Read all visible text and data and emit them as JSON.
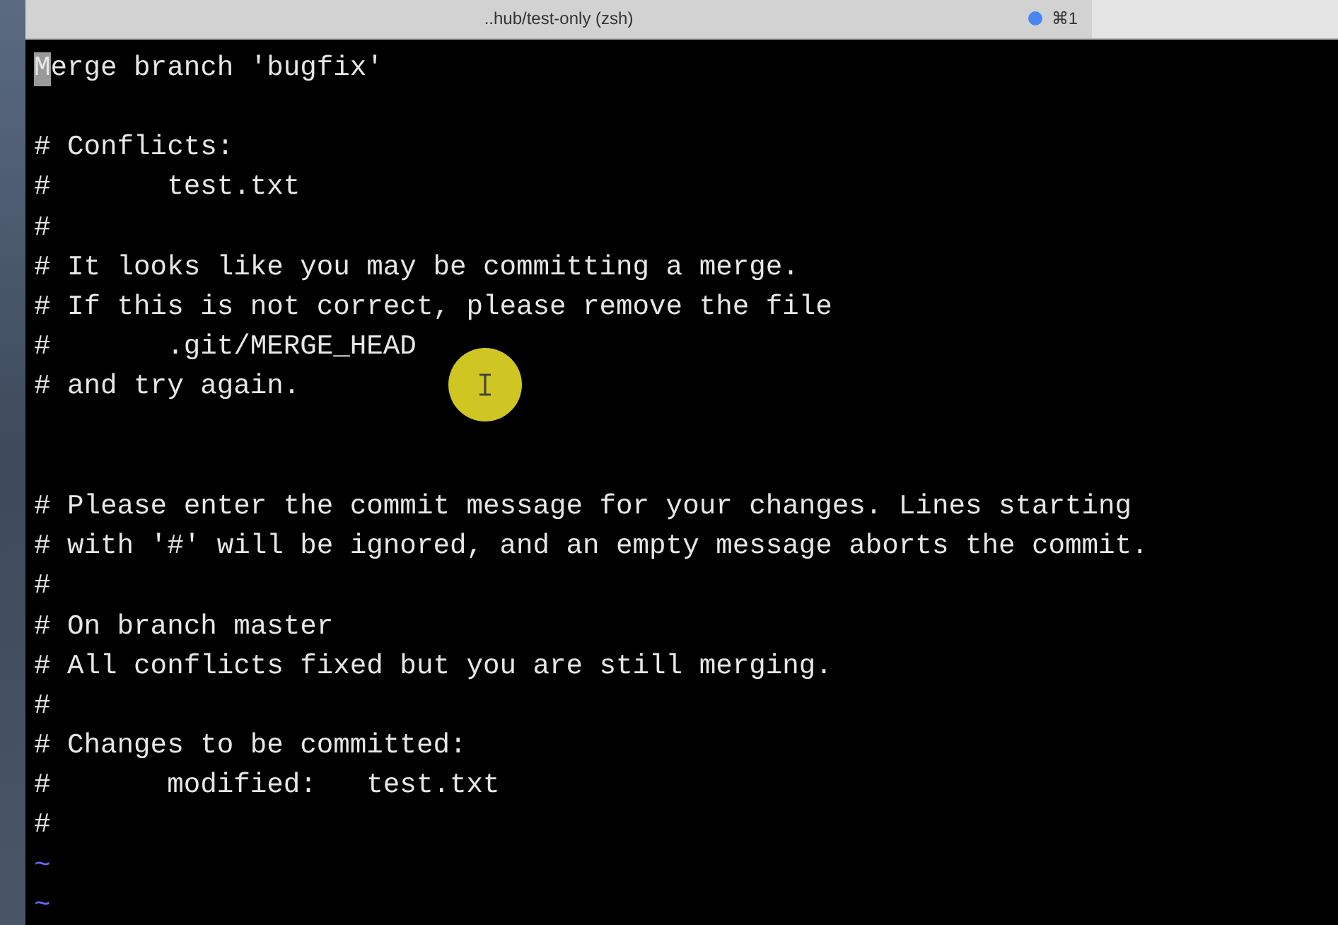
{
  "tab": {
    "title": "..hub/test-only (zsh)",
    "shortcut": "⌘1",
    "selected": true
  },
  "editor": {
    "lines": [
      {
        "kind": "text",
        "text": "Merge branch 'bugfix'",
        "cursor": true
      },
      {
        "kind": "blank"
      },
      {
        "kind": "text",
        "text": "# Conflicts:",
        "cursor": false
      },
      {
        "kind": "text",
        "text": "#       test.txt",
        "cursor": false
      },
      {
        "kind": "text",
        "text": "#",
        "cursor": false
      },
      {
        "kind": "text",
        "text": "# It looks like you may be committing a merge.",
        "cursor": false
      },
      {
        "kind": "text",
        "text": "# If this is not correct, please remove the file",
        "cursor": false
      },
      {
        "kind": "text",
        "text": "#       .git/MERGE_HEAD",
        "cursor": false
      },
      {
        "kind": "text",
        "text": "# and try again.",
        "cursor": false
      },
      {
        "kind": "blank"
      },
      {
        "kind": "blank"
      },
      {
        "kind": "text",
        "text": "# Please enter the commit message for your changes. Lines starting",
        "cursor": false
      },
      {
        "kind": "text",
        "text": "# with '#' will be ignored, and an empty message aborts the commit.",
        "cursor": false
      },
      {
        "kind": "text",
        "text": "#",
        "cursor": false
      },
      {
        "kind": "text",
        "text": "# On branch master",
        "cursor": false
      },
      {
        "kind": "text",
        "text": "# All conflicts fixed but you are still merging.",
        "cursor": false
      },
      {
        "kind": "text",
        "text": "#",
        "cursor": false
      },
      {
        "kind": "text",
        "text": "# Changes to be committed:",
        "cursor": false
      },
      {
        "kind": "text",
        "text": "#       modified:   test.txt",
        "cursor": false
      },
      {
        "kind": "text",
        "text": "#",
        "cursor": false
      },
      {
        "kind": "tilde",
        "text": "~"
      },
      {
        "kind": "tilde",
        "text": "~"
      }
    ]
  }
}
